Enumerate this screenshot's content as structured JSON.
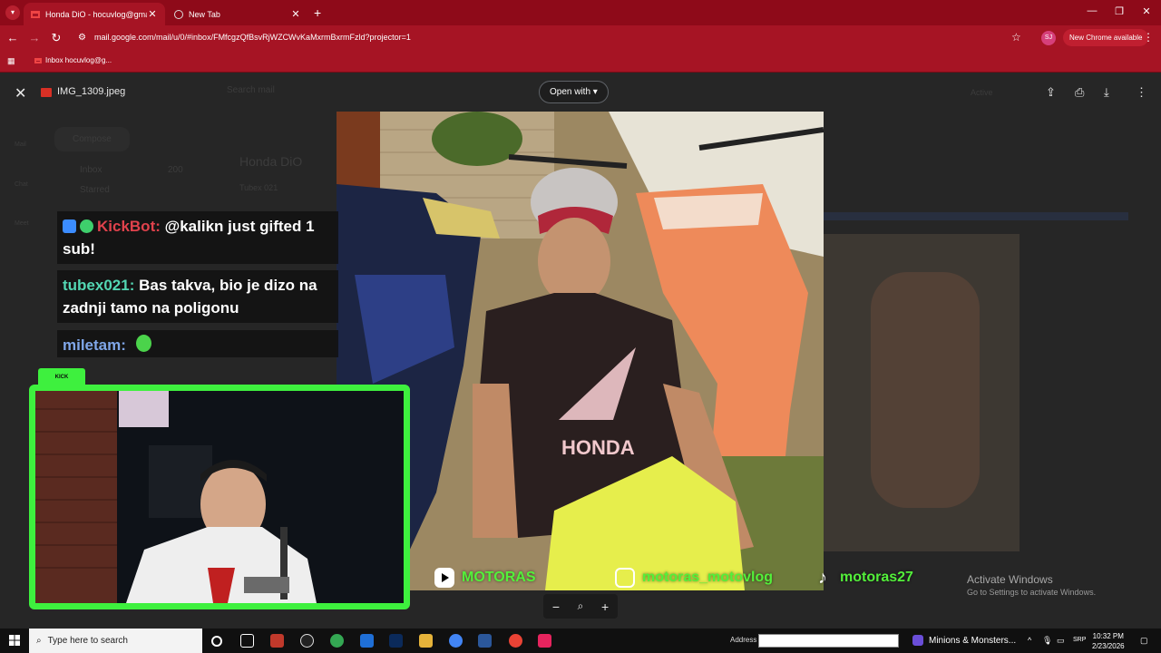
{
  "browser": {
    "tabs": [
      {
        "title": "Honda DiO - hocuvlog@gmail",
        "active": true
      },
      {
        "title": "New Tab",
        "active": false
      }
    ],
    "url": "mail.google.com/mail/u/0/#inbox/FMfcgzQfBsvRjWZCWvKaMxrmBxrmFzld?projector=1",
    "new_chrome_label": "New Chrome available",
    "profile_initials": "SJ",
    "bookmark_label": "Inbox hocuvlog@g...",
    "accent_color": "#a61424"
  },
  "preview": {
    "file_name": "IMG_1309.jpeg",
    "open_with_label": "Open with"
  },
  "gmail_bg": {
    "search_placeholder": "Search mail",
    "compose_label": "Compose",
    "inbox_label": "Inbox",
    "inbox_count": "200",
    "starred_label": "Starred",
    "subject": "Honda DiO",
    "sender": "Tubex 021",
    "status": "Active",
    "mail_label": "Mail",
    "chat_label": "Chat",
    "meet_label": "Meet"
  },
  "stream": {
    "chat": [
      {
        "user": "KickBot:",
        "text": "@kalikn just gifted 1 sub!",
        "color": "#e0424c"
      },
      {
        "user": "tubex021:",
        "text": "Bas takva, bio je dizo na zadnji tamo na poligonu",
        "color": "#53d6b3"
      },
      {
        "user": "miletam:",
        "text": "",
        "color": "#7fa6e8"
      }
    ],
    "kick_tag": "KICK",
    "socials": {
      "youtube": "MOTORAS",
      "instagram": "motoras_motovlog",
      "tiktok": "motoras27"
    },
    "accent_green": "#3ef03e"
  },
  "activate_windows": {
    "title": "Activate Windows",
    "subtitle": "Go to Settings to activate Windows."
  },
  "taskbar": {
    "search_placeholder": "Type here to search",
    "address_label": "Address",
    "media_title": "Minions & Monsters...",
    "language": "SRP",
    "time": "10:32 PM",
    "date": "2/23/2026"
  }
}
